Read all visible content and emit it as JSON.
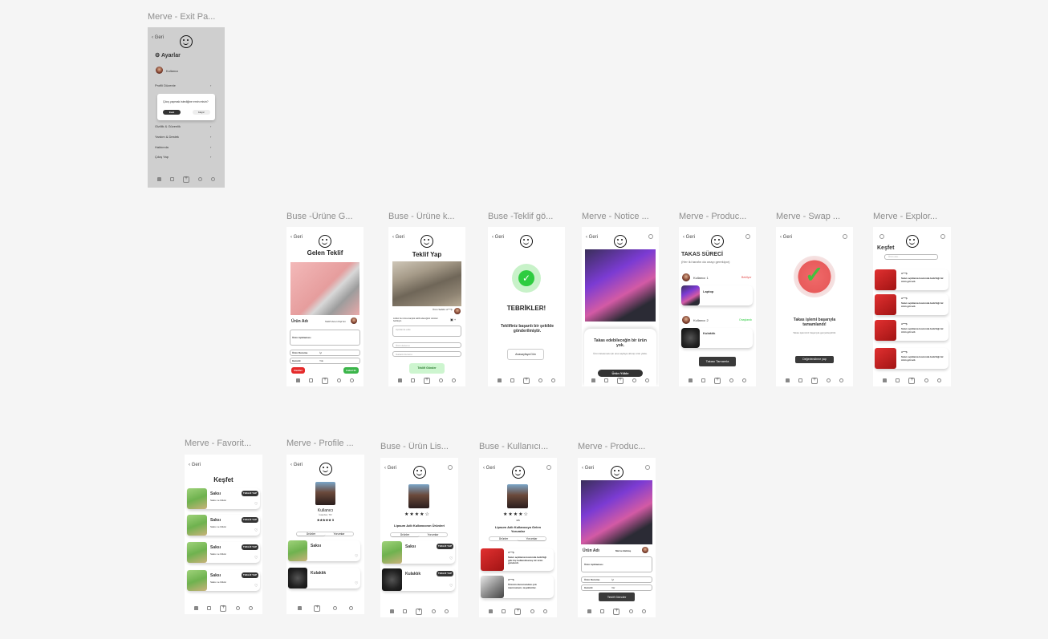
{
  "labels": {
    "exit": "Merve - Exit Pa...",
    "incoming": "Buse -Ürüne  G...",
    "offer": "Buse -  Ürüne k...",
    "congrats": "Buse -Teklif gö...",
    "notice": "Merve - Notice ...",
    "process": "Merve - Produc...",
    "swap": "Merve - Swap ...",
    "explore": "Merve - Explor...",
    "favorites": "Merve - Favorit...",
    "profile": "Merve - Profile ...",
    "list": "Buse - Ürün Lis...",
    "user": "Buse - Kullanıcı...",
    "product": "Merve - Produc..."
  },
  "nav": {
    "back": "Geri"
  },
  "exit": {
    "settings": "Ayarlar",
    "username": "Kullanıcı",
    "items": [
      "Profili Düzenle",
      "Gizlilik & Güvenlik",
      "Yardım & Destek",
      "Hakkında",
      "Çıkış Yap"
    ],
    "dialog_text": "Çıkış yapmak istediğine emin misin?",
    "confirm": "Evet",
    "cancel": "Hayır"
  },
  "incoming": {
    "title": "Gelen Teklif",
    "product_name": "Ürün Adı",
    "owner": "Teklif Veren Kişi'nin",
    "desc_label": "Ürün Açıklaması",
    "status_label": "Ürün Durumu",
    "status_value": "İyi",
    "warranty_label": "Garanti",
    "warranty_value": "Yok",
    "reject": "Reddet",
    "accept": "Kabul Et"
  },
  "offer": {
    "title": "Teklif Yap",
    "seller": "Ürün Sahibi: A***Ş",
    "info": "Lütfen bu ürüne karşılık teklif edeceğiniz ürünleri belirleyin.",
    "field1": "Açıklama ekle",
    "field2": "Ürün durumu",
    "field3": "Garanti durumu",
    "send": "Teklifi Gönder"
  },
  "congrats": {
    "title": "TEBRİKLER!",
    "message": "Teklifiniz başarılı bir şekilde gönderilmiştir.",
    "button": "Anasayfaya Dön"
  },
  "notice": {
    "title": "Takas edebileceğin bir ürün yok.",
    "message": "Ürün listelemek için ana sayfaya dönüp ürün yükle.",
    "button": "Ürün Yükle"
  },
  "process": {
    "title": "TAKAS SÜRECİ",
    "subtitle": "(Her iki tarafın da onayı gerekiyor)",
    "user1": "Kullanıcı 1",
    "status1": "Bekliyor",
    "item1": "Laptop",
    "user2": "Kullanıcı 2",
    "status2": "Onaylandı",
    "item2": "Kulaklık",
    "button": "Takası Tamamla"
  },
  "swap": {
    "title": "Takas işlemi başarıyla tamamlandı!",
    "message": "Takas işleminiz başarıyla gerçekleştirildi.",
    "button": "Değerlendirme yap"
  },
  "explore": {
    "title": "Keşfet",
    "search": "Ürün ara...",
    "seller": "A***Ş",
    "item_text": "Satıcı açıklama kısmında belirttiği bir ürün görseli."
  },
  "favorites": {
    "title": "Keşfet",
    "item": "Saksı",
    "desc": "Saksı ve bitkisi",
    "badge": "TEKLİF YAP"
  },
  "profile": {
    "name": "Kullanıcı",
    "city": "İstanbul, TR",
    "rating": "★★★★★ 5",
    "tab1": "Ürünler",
    "tab2": "Yorumlar",
    "item1": "Saksı",
    "item2": "Kulaklık"
  },
  "list": {
    "stars": "★★★★☆",
    "title": "Lipsum Adlı Kullanıcının Ürünleri",
    "tab1": "Ürünler",
    "tab2": "Yorumlar",
    "item1": "Saksı",
    "item2": "Kulaklık",
    "badge": "TEKLİF YAP"
  },
  "user": {
    "stars": "★★★★☆",
    "score": "4.5",
    "title": "Lipsum Adlı Kullanıcıya Gelen Yorumlar",
    "tab1": "Ürünler",
    "tab2": "Yorumlar",
    "rev_author": "A***Ş",
    "rev1": "Satıcı açıklama kısmında belirttiği gibi hiç kullanılmamış bir ürün gönderdi.",
    "rev2": "Ürünün durumundan çok memnunum, teşekkürler."
  },
  "product": {
    "name": "Ürün Adı",
    "owner": "Merve Bektaş",
    "desc_label": "Ürün Açıklaması",
    "status_label": "Ürün Durumu",
    "status_value": "İyi",
    "warranty_label": "Garanti",
    "warranty_value": "Var",
    "button": "Teklif Gönder"
  },
  "colors": {
    "accent_green": "#2ecc40",
    "reject_red": "#e52b2b",
    "dark": "#333333"
  }
}
